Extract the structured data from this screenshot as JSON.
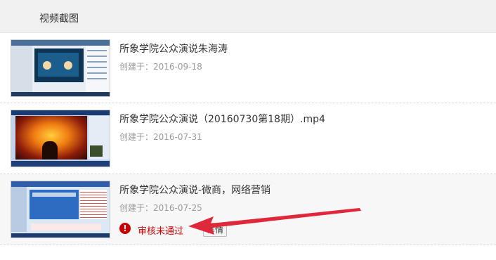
{
  "header": {
    "title": "视频截图"
  },
  "videos": [
    {
      "title": "所象学院公众演说朱海涛",
      "date": "创建于：2016-09-18"
    },
    {
      "title": "所象学院公众演说（20160730第18期）.mp4",
      "date": "创建于：2016-07-31"
    },
    {
      "title": "所象学院公众演说-微商，网络营销",
      "date": "创建于：2016-07-25",
      "status": "审核未通过",
      "detail_button": "详情"
    }
  ],
  "colors": {
    "error": "#cc0000",
    "annotation_arrow": "#e0283c"
  },
  "icons": {
    "status": "exclamation-circle-icon"
  }
}
